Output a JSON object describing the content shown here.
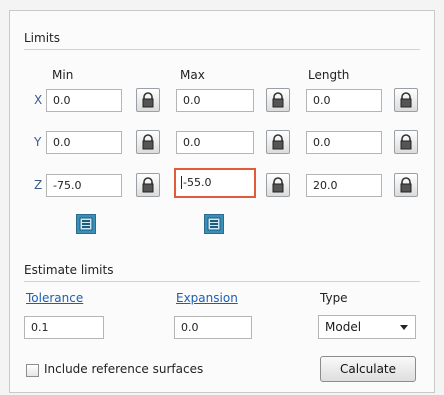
{
  "limits": {
    "title": "Limits",
    "columns": {
      "min": "Min",
      "max": "Max",
      "length": "Length"
    },
    "rows": [
      {
        "axis": "X",
        "min": "0.0",
        "max": "0.0",
        "length": "0.0"
      },
      {
        "axis": "Y",
        "min": "0.0",
        "max": "0.0",
        "length": "0.0"
      },
      {
        "axis": "Z",
        "min": "-75.0",
        "max": "-55.0",
        "length": "20.0"
      }
    ]
  },
  "estimate": {
    "title": "Estimate limits",
    "tolerance_label": "Tolerance",
    "tolerance_value": "0.1",
    "expansion_label": "Expansion",
    "expansion_value": "0.0",
    "type_label": "Type",
    "type_value": "Model",
    "include_label": "Include reference surfaces",
    "calculate_label": "Calculate"
  },
  "colors": {
    "focus_border": "#e05a3c",
    "link": "#1a5fb4",
    "list_button": "#3a8fb8"
  },
  "icons": [
    "padlock-icon",
    "list-picker-icon",
    "dropdown-arrow-icon"
  ]
}
